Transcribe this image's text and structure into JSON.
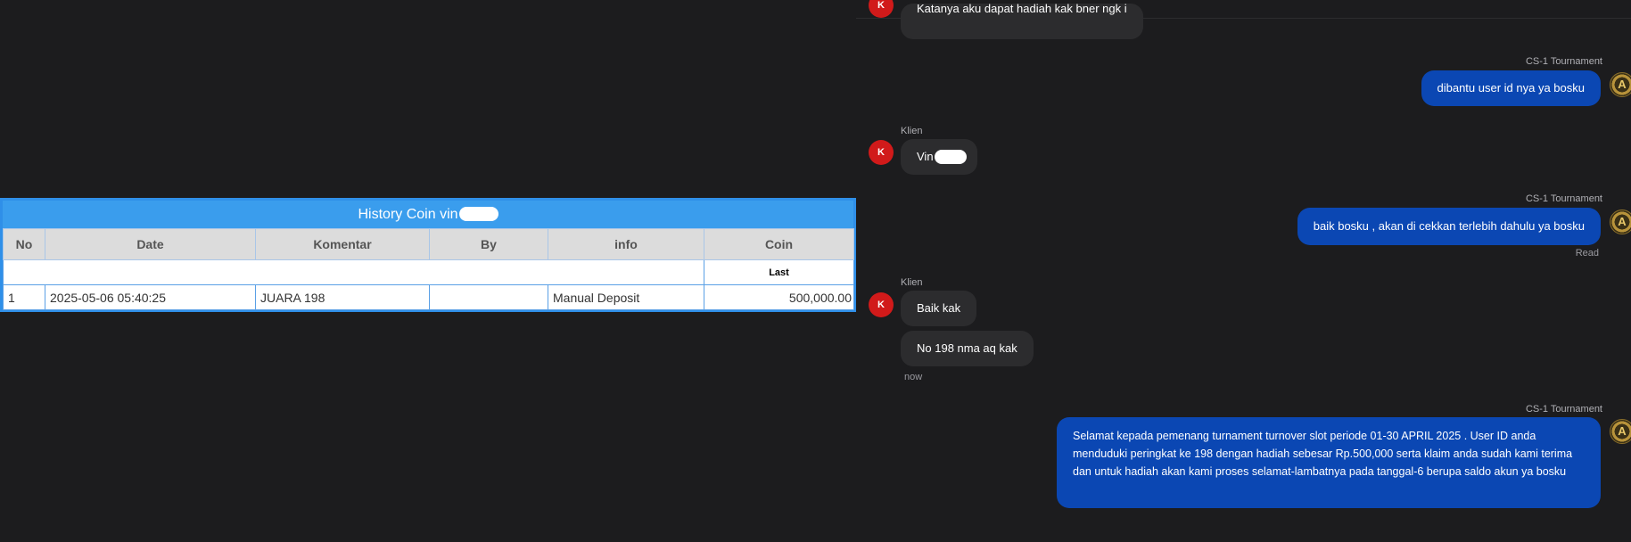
{
  "history": {
    "title": "History Coin vin",
    "columns": [
      "No",
      "Date",
      "Komentar",
      "By",
      "info",
      "Coin"
    ],
    "sub_header": "Last",
    "rows": [
      {
        "no": "1",
        "date": "2025-05-06 05:40:25",
        "komentar": "JUARA 198",
        "by": "",
        "info": "Manual Deposit",
        "coin": "500,000.00"
      }
    ]
  },
  "chat": {
    "top_partial_message": "Katanya aku dapat hadiah kak bner ngk i",
    "messages": [
      {
        "sender": "CS-1 Tournament",
        "text": "dibantu user id nya ya bosku"
      },
      {
        "sender": "Klien",
        "text": "Vin"
      },
      {
        "sender": "CS-1 Tournament",
        "text": "baik bosku , akan di cekkan terlebih dahulu ya bosku",
        "status": "Read"
      },
      {
        "sender": "Klien",
        "text": "Baik kak"
      },
      {
        "sender": "",
        "text": "No 198 nma aq kak",
        "time": "now"
      },
      {
        "sender": "CS-1 Tournament",
        "text": "Selamat kepada pemenang turnament turnover slot periode 01-30 APRIL 2025 . User ID anda menduduki peringkat ke 198 dengan hadiah sebesar Rp.500,000 serta klaim anda sudah kami terima dan untuk hadiah akan kami proses selamat-lambatnya pada tanggal-6 berupa saldo akun ya bosku"
      }
    ],
    "client_avatar_letter": "K",
    "agent_avatar_letter": "A"
  },
  "colors": {
    "background": "#1c1c1e",
    "table_header": "#3a9ded",
    "outgoing_bubble": "#0b47b3",
    "incoming_bubble": "#2c2c2e",
    "client_avatar": "#d11a1a",
    "coin_green": "#1d8a1d"
  }
}
